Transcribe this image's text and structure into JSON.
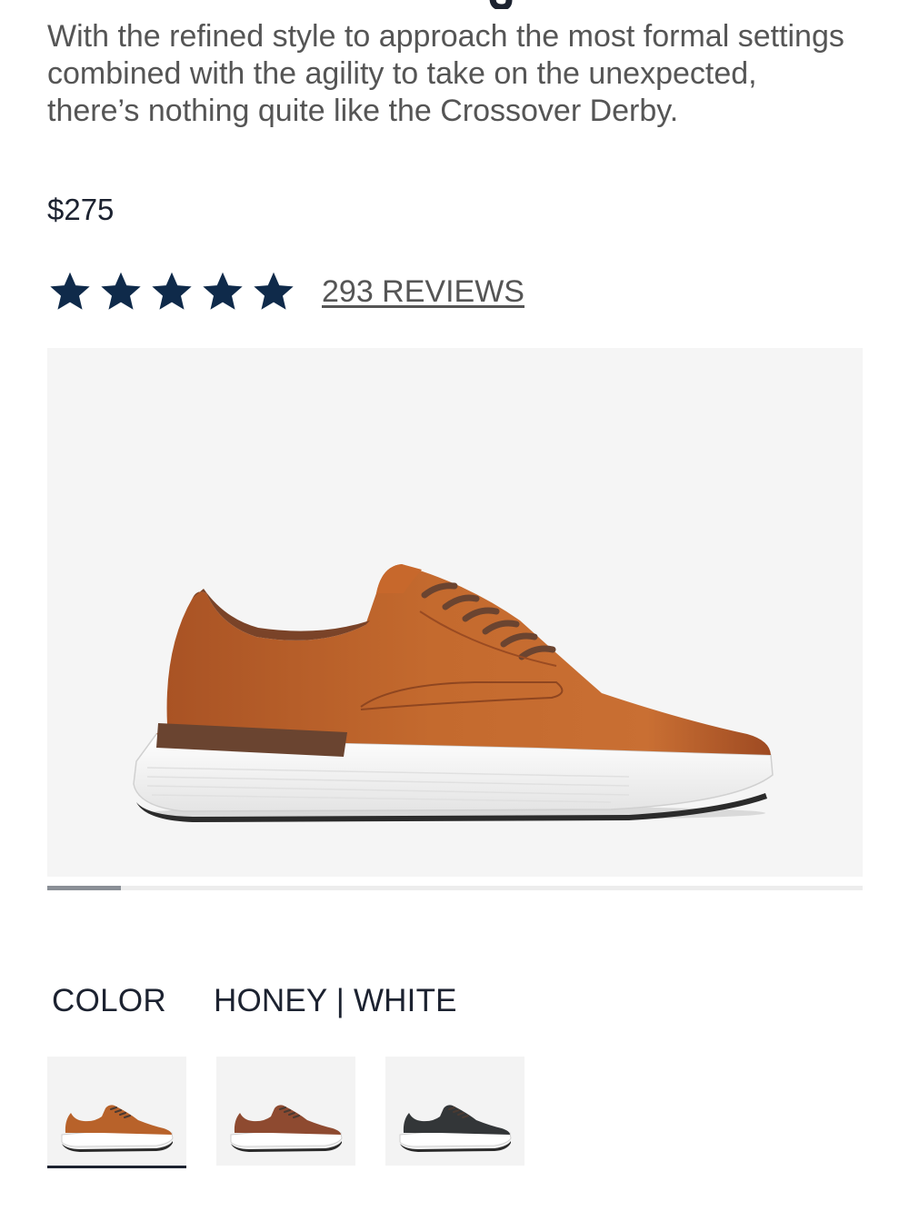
{
  "product": {
    "description": "With the refined style to approach the most formal settings combined with the agility to take on the unexpected, there’s nothing quite like the Crossover Derby.",
    "price": "$275",
    "rating": {
      "stars": 5,
      "max": 5,
      "reviews_label": "293 REVIEWS"
    }
  },
  "gallery": {
    "image": "crossover-derby-shoe-honey-white",
    "progress": 0.09
  },
  "color": {
    "label": "COLOR",
    "selected": "HONEY | WHITE",
    "swatches": [
      {
        "name": "honey-white",
        "upper": "#b8622a",
        "sole": "#ffffff",
        "selected": true
      },
      {
        "name": "brown-white",
        "upper": "#8e4a30",
        "sole": "#ffffff",
        "selected": false
      },
      {
        "name": "black-white",
        "upper": "#333638",
        "sole": "#ffffff",
        "selected": false
      }
    ]
  },
  "colors": {
    "text_dark": "#1c2230",
    "text_body": "#555555",
    "star": "#0f2a4a",
    "image_bg": "#f5f5f5"
  }
}
